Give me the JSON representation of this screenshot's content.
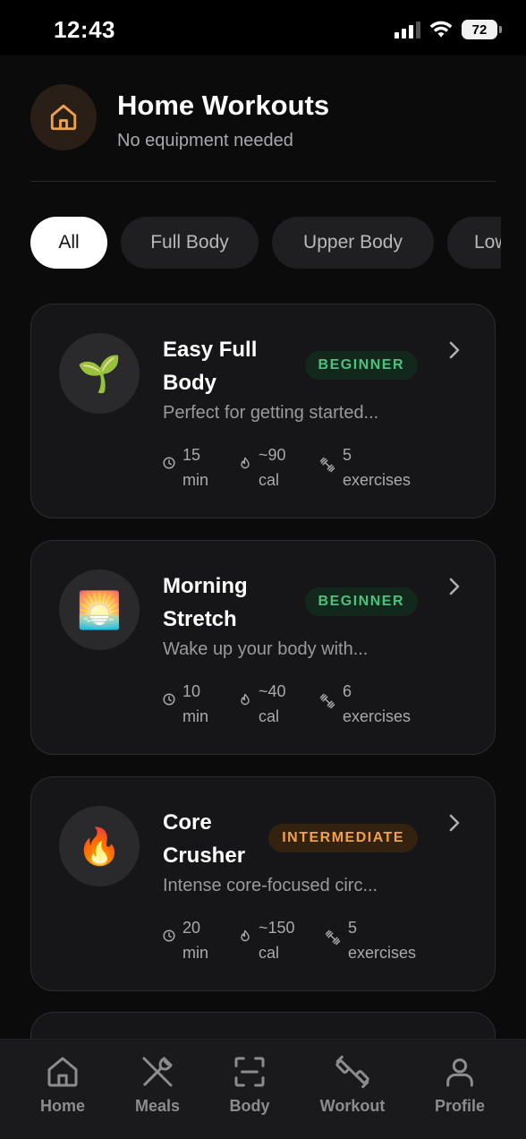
{
  "status": {
    "time": "12:43",
    "battery": "72"
  },
  "header": {
    "title": "Home Workouts",
    "subtitle": "No equipment needed",
    "icon": "home-icon"
  },
  "filters": [
    "All",
    "Full Body",
    "Upper Body",
    "Low"
  ],
  "workouts": [
    {
      "title": "Easy Full Body",
      "badge": "BEGINNER",
      "badge_color": "#4cc27a",
      "description": "Perfect for getting started...",
      "icon": "seedling-emoji",
      "emoji": "🌱",
      "duration": [
        "15",
        "min"
      ],
      "calories": [
        "~90",
        "cal"
      ],
      "exercises": [
        "5",
        "exercises"
      ]
    },
    {
      "title": "Morning Stretch",
      "badge": "BEGINNER",
      "badge_color": "#4cc27a",
      "description": "Wake up your body with...",
      "icon": "sunrise-emoji",
      "emoji": "🌅",
      "duration": [
        "10",
        "min"
      ],
      "calories": [
        "~40",
        "cal"
      ],
      "exercises": [
        "6",
        "exercises"
      ]
    },
    {
      "title": "Core Crusher",
      "badge": "INTERMEDIATE",
      "badge_color": "#f2a14a",
      "description": "Intense core-focused circ...",
      "icon": "fire-emoji",
      "emoji": "🔥",
      "duration": [
        "20",
        "min"
      ],
      "calories": [
        "~150",
        "cal"
      ],
      "exercises": [
        "5",
        "exercises"
      ]
    }
  ],
  "tabs": [
    {
      "label": "Home",
      "icon": "home-icon"
    },
    {
      "label": "Meals",
      "icon": "utensils-icon"
    },
    {
      "label": "Body",
      "icon": "scan-icon"
    },
    {
      "label": "Workout",
      "icon": "dumbbell-icon"
    },
    {
      "label": "Profile",
      "icon": "user-icon"
    }
  ],
  "colors": {
    "accent": "#f2a14a",
    "background": "#0b0b0c",
    "card": "#161618"
  }
}
